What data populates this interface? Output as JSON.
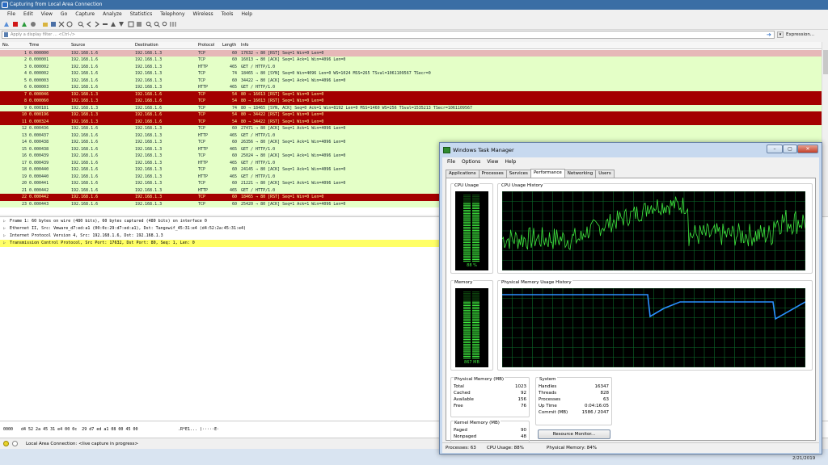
{
  "wireshark": {
    "title": "Capturing from Local Area Connection",
    "menu": [
      "File",
      "Edit",
      "View",
      "Go",
      "Capture",
      "Analyze",
      "Statistics",
      "Telephony",
      "Wireless",
      "Tools",
      "Help"
    ],
    "filter_placeholder": "Apply a display filter ... <Ctrl-/>",
    "expression_label": "Expression...",
    "columns": [
      "No.",
      "Time",
      "Source",
      "Destination",
      "Protocol",
      "Length",
      "Info"
    ],
    "packets": [
      [
        "1",
        "0.000000",
        "192.168.1.6",
        "192.168.1.3",
        "TCP",
        "60",
        "17632 → 80 [RST] Seq=1 Win=0 Len=0",
        "sel"
      ],
      [
        "2",
        "0.000001",
        "192.168.1.6",
        "192.168.1.3",
        "TCP",
        "60",
        "16013 → 80 [ACK] Seq=1 Ack=1 Win=4096 Len=0",
        "green"
      ],
      [
        "3",
        "0.000002",
        "192.168.1.6",
        "192.168.1.3",
        "HTTP",
        "465",
        "GET / HTTP/1.0",
        "green"
      ],
      [
        "4",
        "0.000002",
        "192.168.1.6",
        "192.168.1.3",
        "TCP",
        "74",
        "18465 → 80 [SYN] Seq=0 Win=4096 Len=0 WS=1024 MSS=265 TSval=1061109567 TSecr=0",
        "green"
      ],
      [
        "5",
        "0.000003",
        "192.168.1.6",
        "192.168.1.3",
        "TCP",
        "60",
        "34422 → 80 [ACK] Seq=1 Ack=1 Win=4096 Len=0",
        "green"
      ],
      [
        "6",
        "0.000003",
        "192.168.1.6",
        "192.168.1.3",
        "HTTP",
        "465",
        "GET / HTTP/1.0",
        "green"
      ],
      [
        "7",
        "0.000046",
        "192.168.1.3",
        "192.168.1.6",
        "TCP",
        "54",
        "80 → 16013 [RST] Seq=1 Win=0 Len=0",
        "red"
      ],
      [
        "8",
        "0.000060",
        "192.168.1.3",
        "192.168.1.6",
        "TCP",
        "54",
        "80 → 16013 [RST] Seq=1 Win=0 Len=0",
        "red"
      ],
      [
        "9",
        "0.000181",
        "192.168.1.3",
        "192.168.1.6",
        "TCP",
        "74",
        "80 → 18465 [SYN, ACK] Seq=0 Ack=1 Win=8192 Len=0 MSS=1460 WS=256 TSval=1535213 TSecr=1061109567",
        "green"
      ],
      [
        "10",
        "0.000196",
        "192.168.1.3",
        "192.168.1.6",
        "TCP",
        "54",
        "80 → 34422 [RST] Seq=1 Win=0 Len=0",
        "red"
      ],
      [
        "11",
        "0.000324",
        "192.168.1.3",
        "192.168.1.6",
        "TCP",
        "54",
        "80 → 34422 [RST] Seq=1 Win=0 Len=0",
        "red"
      ],
      [
        "12",
        "0.000436",
        "192.168.1.6",
        "192.168.1.3",
        "TCP",
        "60",
        "27471 → 80 [ACK] Seq=1 Ack=1 Win=4096 Len=0",
        "green"
      ],
      [
        "13",
        "0.000437",
        "192.168.1.6",
        "192.168.1.3",
        "HTTP",
        "465",
        "GET / HTTP/1.0",
        "green"
      ],
      [
        "14",
        "0.000438",
        "192.168.1.6",
        "192.168.1.3",
        "TCP",
        "60",
        "26356 → 80 [ACK] Seq=1 Ack=1 Win=4096 Len=0",
        "green"
      ],
      [
        "15",
        "0.000438",
        "192.168.1.6",
        "192.168.1.3",
        "HTTP",
        "465",
        "GET / HTTP/1.0",
        "green"
      ],
      [
        "16",
        "0.000439",
        "192.168.1.6",
        "192.168.1.3",
        "TCP",
        "60",
        "25024 → 80 [ACK] Seq=1 Ack=1 Win=4096 Len=0",
        "green"
      ],
      [
        "17",
        "0.000439",
        "192.168.1.6",
        "192.168.1.3",
        "HTTP",
        "465",
        "GET / HTTP/1.0",
        "green"
      ],
      [
        "18",
        "0.000440",
        "192.168.1.6",
        "192.168.1.3",
        "TCP",
        "60",
        "24145 → 80 [ACK] Seq=1 Ack=1 Win=4096 Len=0",
        "green"
      ],
      [
        "19",
        "0.000440",
        "192.168.1.6",
        "192.168.1.3",
        "HTTP",
        "465",
        "GET / HTTP/1.0",
        "green"
      ],
      [
        "20",
        "0.000441",
        "192.168.1.6",
        "192.168.1.3",
        "TCP",
        "60",
        "21221 → 80 [ACK] Seq=1 Ack=1 Win=4096 Len=0",
        "green"
      ],
      [
        "21",
        "0.000442",
        "192.168.1.6",
        "192.168.1.3",
        "HTTP",
        "465",
        "GET / HTTP/1.0",
        "green"
      ],
      [
        "22",
        "0.000442",
        "192.168.1.6",
        "192.168.1.3",
        "TCP",
        "60",
        "18465 → 80 [RST] Seq=1 Win=0 Len=0",
        "red"
      ],
      [
        "23",
        "0.000443",
        "192.168.1.6",
        "192.168.1.3",
        "TCP",
        "60",
        "25420 → 80 [ACK] Seq=1 Ack=1 Win=4096 Len=0",
        "green"
      ]
    ],
    "details": [
      "Frame 1: 60 bytes on wire (480 bits), 60 bytes captured (480 bits) on interface 0",
      "Ethernet II, Src: Vmware_d7:ed:a1 (00:0c:29:d7:ed:a1), Dst: Tangowif_45:31:e4 (d4:52:2a:45:31:e4)",
      "Internet Protocol Version 4, Src: 192.168.1.6, Dst: 192.168.1.3",
      "Transmission Control Protocol, Src Port: 17632, Dst Port: 80, Seq: 1, Len: 0"
    ],
    "bytes_offset": "0000",
    "bytes_hex": "d4 52 2a 45 31 e4 00 0c  29 d7 ed a1 08 00 45 00",
    "bytes_ascii": ".R*E1... )·····E·",
    "status_text": "Local Area Connection: <live capture in progress>",
    "clock": "2/21/2019",
    "colors": {
      "green_row": "#e4ffc7",
      "red_row": "#a40000",
      "selected_row": "#e6b8b8",
      "highlight": "#ffff66"
    }
  },
  "taskmgr": {
    "title": "Windows Task Manager",
    "menu": [
      "File",
      "Options",
      "View",
      "Help"
    ],
    "tabs": [
      "Applications",
      "Processes",
      "Services",
      "Performance",
      "Networking",
      "Users"
    ],
    "active_tab": "Performance",
    "cpu_usage_label": "CPU Usage",
    "cpu_history_label": "CPU Usage History",
    "memory_label": "Memory",
    "memory_history_label": "Physical Memory Usage History",
    "cpu_meter_text": "88 %",
    "cpu_fraction": 0.88,
    "mem_meter_text": "867 MB",
    "mem_fraction": 0.84,
    "physical_memory": {
      "title": "Physical Memory (MB)",
      "rows": [
        [
          "Total",
          "1023"
        ],
        [
          "Cached",
          "92"
        ],
        [
          "Available",
          "156"
        ],
        [
          "Free",
          "76"
        ]
      ]
    },
    "kernel_memory": {
      "title": "Kernel Memory (MB)",
      "rows": [
        [
          "Paged",
          "90"
        ],
        [
          "Nonpaged",
          "48"
        ]
      ]
    },
    "system": {
      "title": "System",
      "rows": [
        [
          "Handles",
          "16347"
        ],
        [
          "Threads",
          "828"
        ],
        [
          "Processes",
          "63"
        ],
        [
          "Up Time",
          "0:04:16:05"
        ],
        [
          "Commit (MB)",
          "1586 / 2047"
        ]
      ]
    },
    "resource_monitor_label": "Resource Monitor...",
    "status": {
      "processes": "Processes: 63",
      "cpu": "CPU Usage: 88%",
      "memory": "Physical Memory: 84%"
    },
    "colors": {
      "graph_bg": "#000000",
      "grid": "#0d6b2a",
      "cpu_line": "#3ee63e",
      "mem_line": "#2a90ff"
    }
  }
}
